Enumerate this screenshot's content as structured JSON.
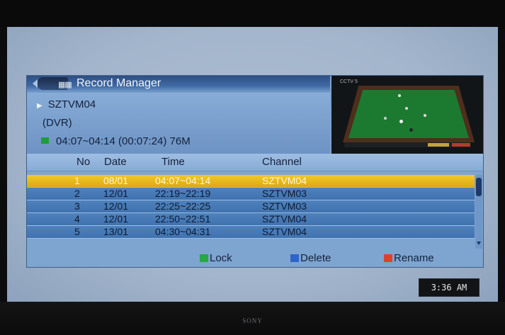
{
  "tv": {
    "brand": "SONY"
  },
  "osd": {
    "title": "Record Manager",
    "title_icon": "film-clapper-icon",
    "channel_name": "SZTVM04",
    "channel_type": "(DVR)",
    "record_info": "04:07~04:14 (00:07:24) 76M",
    "preview_logo": "CCTV 5"
  },
  "table": {
    "headers": {
      "no": "No",
      "date": "Date",
      "time": "Time",
      "channel": "Channel"
    },
    "rows": [
      {
        "no": "1",
        "date": "08/01",
        "time": "04:07~04:14",
        "channel": "SZTVM04"
      },
      {
        "no": "2",
        "date": "12/01",
        "time": "22:19~22:19",
        "channel": "SZTVM03"
      },
      {
        "no": "3",
        "date": "12/01",
        "time": "22:25~22:25",
        "channel": "SZTVM03"
      },
      {
        "no": "4",
        "date": "12/01",
        "time": "22:50~22:51",
        "channel": "SZTVM04"
      },
      {
        "no": "5",
        "date": "13/01",
        "time": "04:30~04:31",
        "channel": "SZTVM04"
      }
    ],
    "selected_row": 1
  },
  "actions": {
    "lock": {
      "label": "Lock",
      "color": "#28a745"
    },
    "delete": {
      "label": "Delete",
      "color": "#2f63c9"
    },
    "rename": {
      "label": "Rename",
      "color": "#e0402b"
    }
  },
  "clock": {
    "time": "3:36 AM"
  },
  "colors": {
    "selected_row": "#f0c21f",
    "row": "#4477b4",
    "title_bar": "#2e4f82"
  }
}
